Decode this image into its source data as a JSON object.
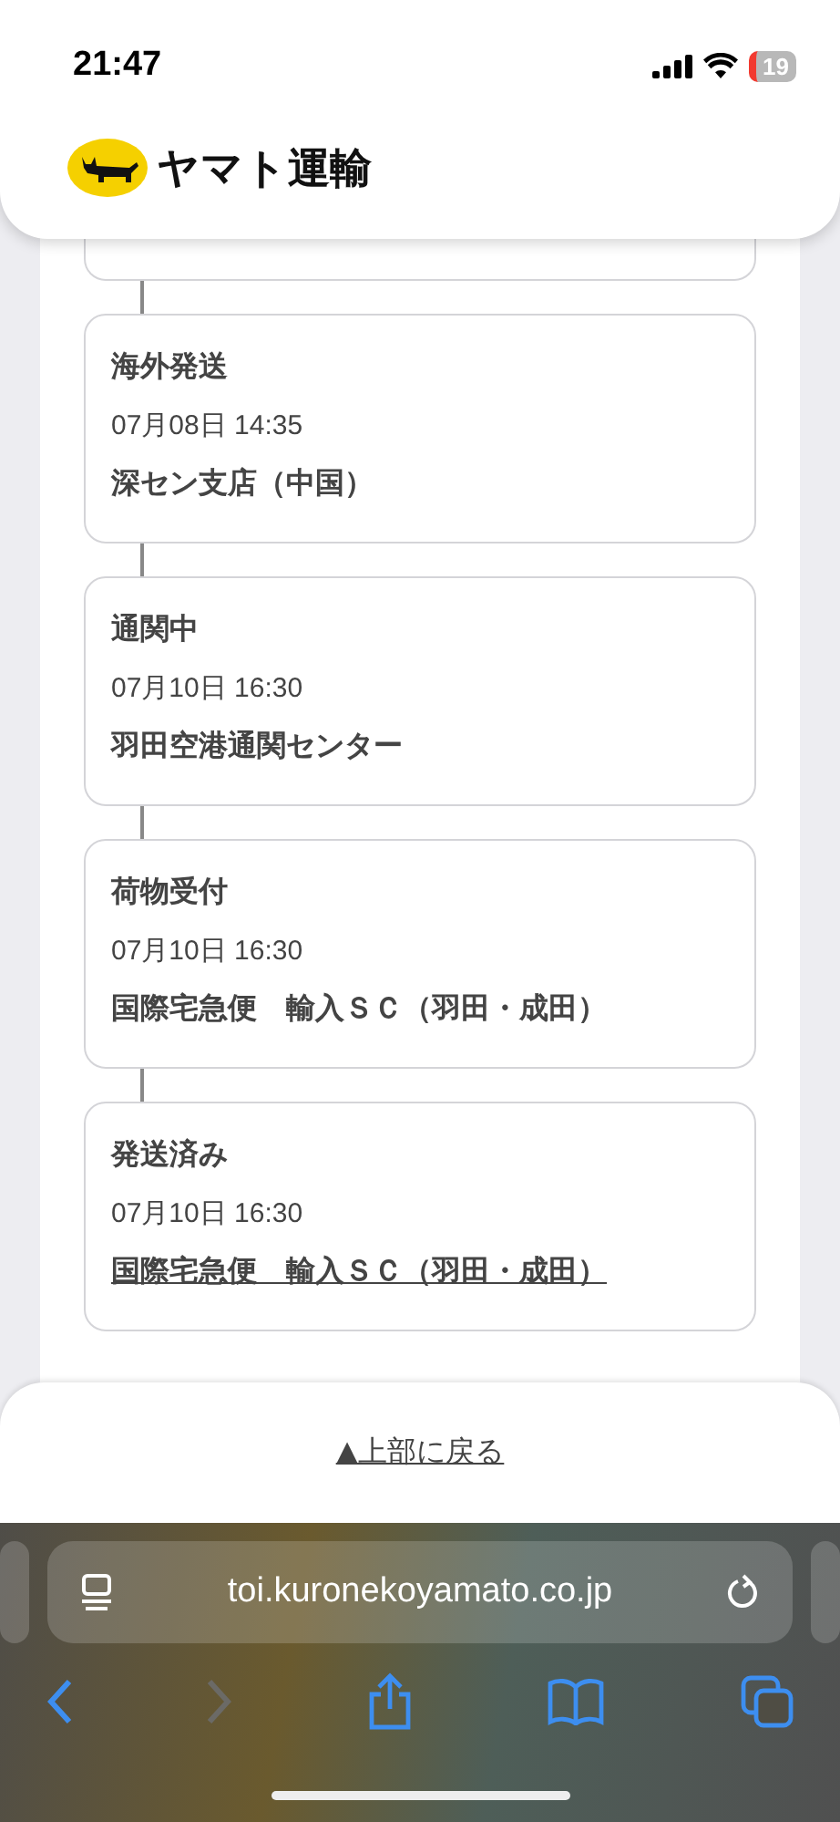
{
  "status_bar": {
    "time": "21:47",
    "battery": "19"
  },
  "header": {
    "logo_text": "ヤマト運輸"
  },
  "events": [
    {
      "status": "海外発送",
      "datetime": "07月08日 14:35",
      "location": "深セン支店（中国）",
      "kind": "text"
    },
    {
      "status": "通関中",
      "datetime": "07月10日 16:30",
      "location": "羽田空港通関センター",
      "kind": "text"
    },
    {
      "status": "荷物受付",
      "datetime": "07月10日 16:30",
      "location": "国際宅急便　輸入ＳＣ（羽田・成田）",
      "kind": "text"
    },
    {
      "status": "発送済み",
      "datetime": "07月10日 16:30",
      "location": "国際宅急便　輸入ＳＣ（羽田・成田）",
      "kind": "link"
    }
  ],
  "back_to_top": "▲上部に戻る",
  "browser": {
    "url": "toi.kuronekoyamato.co.jp",
    "back_disabled": false,
    "forward_disabled": true
  }
}
